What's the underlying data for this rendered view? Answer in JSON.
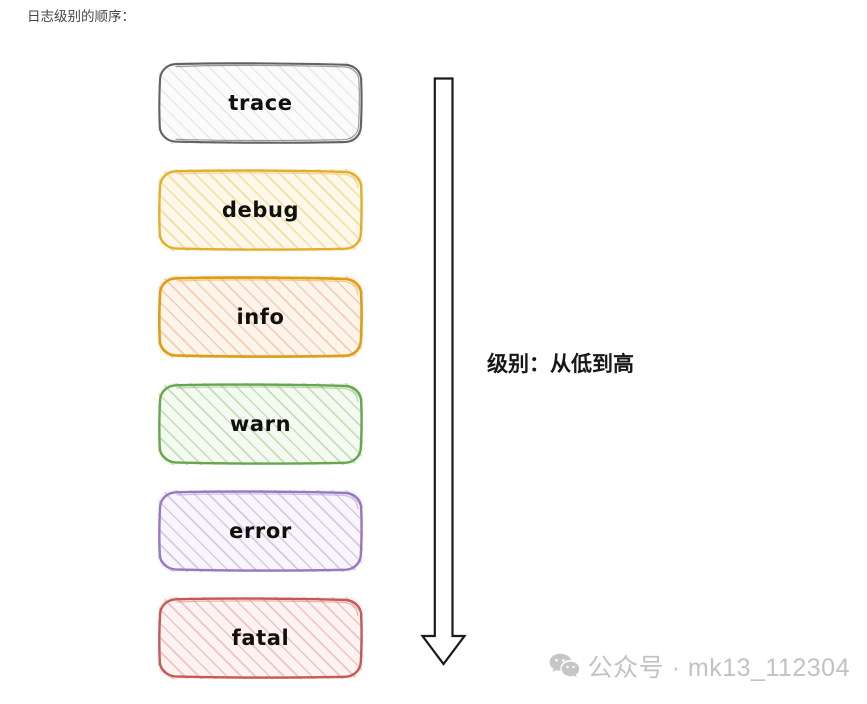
{
  "page": {
    "caption": "日志级别的顺序：",
    "background_color": "#ffffff"
  },
  "diagram": {
    "type": "flow-sequence",
    "orientation": "vertical",
    "style": "hand-drawn-sketch",
    "levels": [
      {
        "label": "trace",
        "order": 1,
        "stroke_color": "#5f6368",
        "fill_color": "#fbfbfb",
        "hatch_color": "#e2e2e2"
      },
      {
        "label": "debug",
        "order": 2,
        "stroke_color": "#e3ae2f",
        "fill_color": "#fdf8ea",
        "hatch_color": "#f2dea2"
      },
      {
        "label": "info",
        "order": 3,
        "stroke_color": "#e09c12",
        "fill_color": "#fdf4ec",
        "hatch_color": "#f6cdb2"
      },
      {
        "label": "warn",
        "order": 4,
        "stroke_color": "#68a550",
        "fill_color": "#f4faf1",
        "hatch_color": "#c3e0b5"
      },
      {
        "label": "error",
        "order": 5,
        "stroke_color": "#9878c0",
        "fill_color": "#f8f5fb",
        "hatch_color": "#d8c8e8"
      },
      {
        "label": "fatal",
        "order": 6,
        "stroke_color": "#c35a56",
        "fill_color": "#fdf3f2",
        "hatch_color": "#f0c3bf"
      }
    ],
    "arrow": {
      "name": "level-direction-arrow",
      "direction": "down",
      "style": "outlined-block-arrow",
      "stroke_color": "#1a1a1a",
      "fill_color": "#ffffff",
      "caption": "级别：从低到高"
    }
  },
  "watermark": {
    "icon": "wechat-icon",
    "text": "公众号 · mk13_112304",
    "color": "#c2c2c2"
  }
}
